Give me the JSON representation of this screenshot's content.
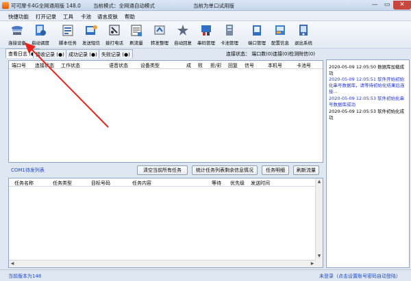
{
  "title": {
    "app_name": "可可摩卡4G全网通用版 148.0",
    "mode": "当前模式：全网通自动模式",
    "version_note": "当前为单口试用版"
  },
  "menu": [
    "快捷功能",
    "打开记录",
    "工具",
    "卡池",
    "语言皮肤",
    "帮助"
  ],
  "toolbar": [
    {
      "label": "连接设备",
      "icon": "connect-device-icon"
    },
    {
      "label": "启动调度",
      "icon": "start-schedule-icon"
    },
    {
      "label": "脚本任务",
      "icon": "script-task-icon"
    },
    {
      "label": "发送短信",
      "icon": "send-sms-icon"
    },
    {
      "label": "拨打电话",
      "icon": "dial-phone-icon"
    },
    {
      "label": "刷流量",
      "icon": "refresh-traffic-icon"
    },
    {
      "label": "转发整理",
      "icon": "forward-icon"
    },
    {
      "label": "自动回复",
      "icon": "auto-reply-icon"
    },
    {
      "label": "串码管理",
      "icon": "imei-manage-icon"
    },
    {
      "label": "卡池管理",
      "icon": "card-pool-icon"
    },
    {
      "label": "端口管理",
      "icon": "port-manage-icon"
    },
    {
      "label": "配置信息",
      "icon": "config-icon"
    },
    {
      "label": "退出系统",
      "icon": "exit-icon"
    }
  ],
  "tabs": [
    "查看日志 (●)",
    "接收记录 (●)",
    "成功记录 (●)",
    "失败记录 (●)"
  ],
  "connection_status": "连接状态： 端口数(0)连接(0)检测附信(0)",
  "device_table": {
    "columns": [
      "端口号",
      "连接状态",
      "工作状态",
      "语音状态",
      "设备类型",
      "成",
      "败",
      "拒/彩",
      "回复",
      "信号",
      "本机号",
      "卡池号"
    ]
  },
  "com_section": {
    "label": "COM1待发列表",
    "buttons": [
      "清空当前所有任务",
      "统计任务列表剩余信息情况",
      "任务明细",
      "刷新流量"
    ]
  },
  "task_table": {
    "columns": [
      "任务名称",
      "任务类型",
      "目标号码",
      "任务内容",
      "等待",
      "优先级",
      "发送时间"
    ]
  },
  "log": [
    {
      "time": "2020-05-09 12:05:50",
      "text": "数据库加载成功",
      "color": "black"
    },
    {
      "time": "2020-05-09 12:05:51",
      "text": "软件开始初始化串号数据库，请等待初始化结果后连接...",
      "color": "blue"
    },
    {
      "time": "2020-05-09 12:05:53",
      "text": "软件初始化串号数据库成功",
      "color": "blue"
    },
    {
      "time": "2020-05-09 12:05:53",
      "text": "软件初始化成功",
      "color": "black"
    }
  ],
  "statusbar": {
    "version": "当前版本为148",
    "register": "未登录（点击设置账号密码自动登陆）"
  },
  "colors": {
    "accent": "#1b47c9",
    "arrow": "#e8231b"
  }
}
